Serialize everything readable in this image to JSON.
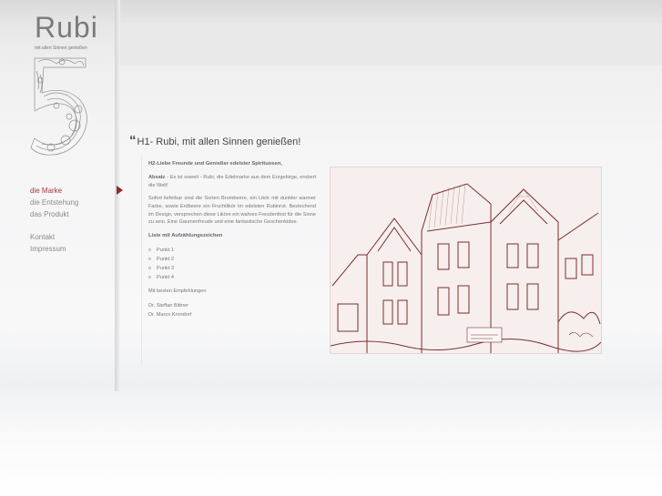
{
  "brand": {
    "name": "Rubi",
    "tagline": "mit allen Sinnen genießen",
    "numeral_icon": "number-five-logo"
  },
  "nav": {
    "items": [
      {
        "label": "die Marke",
        "active": true
      },
      {
        "label": "die Entstehung",
        "active": false
      },
      {
        "label": "das Produkt",
        "active": false
      }
    ],
    "secondary": [
      {
        "label": "Kontakt"
      },
      {
        "label": "Impressum"
      }
    ]
  },
  "page": {
    "title": "H1- Rubi, mit allen Sinnen genießen!",
    "quote_mark": "“",
    "h2": "H2-Liebe Freunde und Genießer edelster Spirituosen,",
    "para1_label": "Absatz",
    "para1_text": " - Es ist soweit - Rubi, die Edelmarke aus dem Erzgebirge, erobert die Welt!",
    "para2": "Sofort lieferbar sind die Sorten Brombeere, ein Likör mit dunkler warmer Farbe, sowie Erdbeere ein Fruchtlikör im edelsten Rubinrot. Bestechend im Design, versprechen diese Liköre ein wahres Freudenfest für die Sinne zu sein. Eine Gaumenfreude und eine fantastische Geschenkidee.",
    "list_heading": "Liste mit Aufzählungszeichen",
    "list": [
      "Punkt 1",
      "Punkt 2",
      "Punkt 3",
      "Punkt 4"
    ],
    "closing": "Mit besten Empfehlungen",
    "signers": [
      "Dr. Steffan Bittner",
      "Dr. Marco Krondorf"
    ]
  },
  "colors": {
    "accent": "#a33a3a",
    "nav_text": "#8a8a8a",
    "body_text": "#777777"
  }
}
